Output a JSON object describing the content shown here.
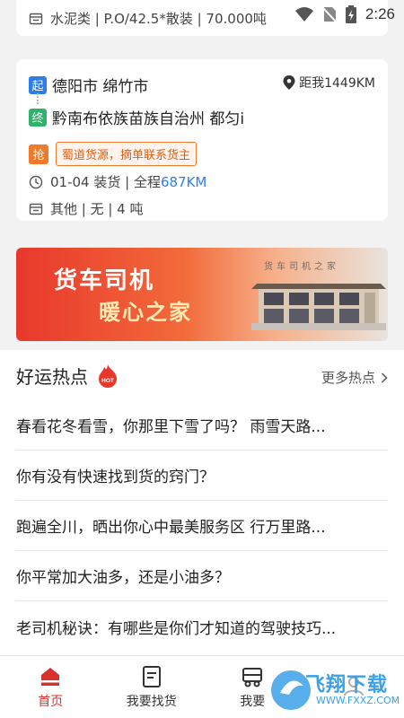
{
  "status_bar": {
    "time": "2:26"
  },
  "prev_card": {
    "spec_text": "水泥类 | P.O/42.5*散装 | 70.000吨"
  },
  "order": {
    "from_tag": "起",
    "from": "德阳市 绵竹市",
    "to_tag": "终",
    "to": "黔南布依族苗族自治州 都匀i",
    "distance": "距我1449KM",
    "grab_tag": "抢",
    "grab_note": "蜀道货源，摘单联系货主",
    "load_prefix": "01-04 装货 | 全程",
    "load_distance": "687KM",
    "spec": "其他 | 无 | 4 吨"
  },
  "banner": {
    "line1": "货车司机",
    "line2": "暖心之家",
    "sign": "货车司机之家"
  },
  "hot": {
    "title": "好运热点",
    "badge": "HOT",
    "more": "更多热点",
    "items": [
      "春看花冬看雪，你那里下雪了吗？ 雨雪天路...",
      "你有没有快速找到货的窍门？",
      "跑遍全川，晒出你心中最美服务区 行万里路...",
      "你平常加大油多，还是小油多？",
      "老司机秘诀：有哪些是你们才知道的驾驶技巧..."
    ]
  },
  "nav": {
    "items": [
      {
        "label": "首页"
      },
      {
        "label": "我要找货"
      },
      {
        "label": "我要"
      },
      {
        "label": ""
      }
    ]
  },
  "watermark": {
    "text": "飞翔下载",
    "url": "WWW.FXXZ.COM"
  },
  "colors": {
    "brand_red": "#d8302a",
    "blue": "#2b7de9",
    "orange": "#f07a2a"
  }
}
